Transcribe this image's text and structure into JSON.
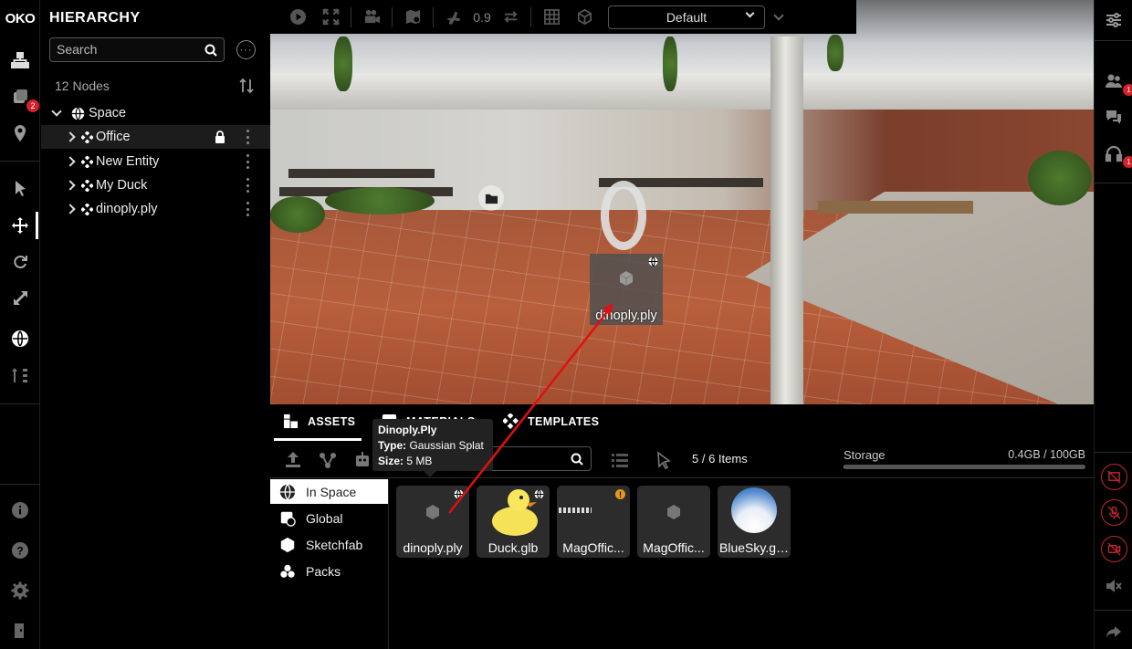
{
  "app": {
    "logo_text": "OKO",
    "title": "HIERARCHY"
  },
  "left_rail": {
    "badge_count": "2",
    "icons": [
      "hierarchy-icon",
      "inventory-icon",
      "location-pin-icon",
      "pointer-icon",
      "move-icon",
      "rotate-icon",
      "scale-icon",
      "globe-icon",
      "sort-icon",
      "info-icon",
      "help-icon",
      "settings-icon",
      "exit-icon"
    ]
  },
  "hierarchy": {
    "search_placeholder": "Search",
    "nodes_count": "12 Nodes",
    "root": "Space",
    "nodes": [
      {
        "label": "Office",
        "locked": true,
        "selected": true
      },
      {
        "label": "New Entity",
        "locked": false,
        "selected": false
      },
      {
        "label": "My Duck",
        "locked": false,
        "selected": false
      },
      {
        "label": "dinoply.ply",
        "locked": false,
        "selected": false
      }
    ]
  },
  "viewport": {
    "speed_value": "0.9",
    "view_mode": "Default",
    "selected_object_label": "dinoply.ply"
  },
  "right_rail": {
    "people_badge": "1",
    "audio_badge": "1"
  },
  "bottom_panel": {
    "tabs": [
      "ASSETS",
      "MATERIALS",
      "TEMPLATES"
    ],
    "active_tab": "ASSETS",
    "items_count": "5 / 6 Items",
    "storage_label": "Storage",
    "storage_value": "0.4GB / 100GB",
    "storage_used_fraction": 0.004,
    "sources": [
      "In Space",
      "Global",
      "Sketchfab",
      "Packs"
    ],
    "active_source": "In Space",
    "assets": [
      {
        "name": "dinoply.ply",
        "thumb": "cube"
      },
      {
        "name": "Duck.glb",
        "thumb": "duck"
      },
      {
        "name": "MagOffic...",
        "thumb": "office",
        "warning": true,
        "warning_mark": "!"
      },
      {
        "name": "MagOffic...",
        "thumb": "cube"
      },
      {
        "name": "BlueSky.gl...",
        "thumb": "sky"
      }
    ],
    "tooltip": {
      "title": "Dinoply.Ply",
      "type_label": "Type:",
      "type_value": "Gaussian Splat",
      "size_label": "Size:",
      "size_value": "5 MB"
    }
  }
}
